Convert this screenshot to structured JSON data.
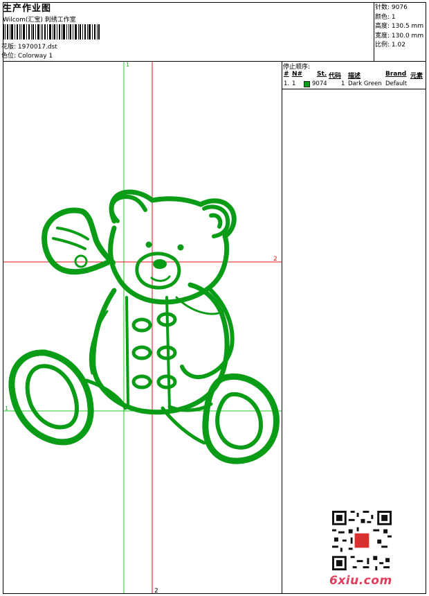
{
  "header": {
    "title": "生产作业图",
    "subtitle": "Wilcom(汇宝) 刺绣工作室",
    "file_label": "花版:",
    "file_value": "1970017.dst",
    "colorway_label": "色位:",
    "colorway_value": "Colorway 1"
  },
  "stats": {
    "stitches_label": "针数:",
    "stitches_value": "9076",
    "colors_label": "颜色:",
    "colors_value": "1",
    "height_label": "高度:",
    "height_value": "130.5 mm",
    "width_label": "宽度:",
    "width_value": "130.0 mm",
    "scale_label": "比例:",
    "scale_value": "1.02"
  },
  "guides": {
    "green_top": "1",
    "green_left": "1",
    "red_right": "2",
    "red_bottom": "2"
  },
  "stop_sequence": {
    "title": "停止顺序:",
    "headers": {
      "num": "#",
      "no": "N#",
      "st": "St.",
      "code": "代码",
      "desc": "描述",
      "brand": "Brand",
      "element": "元素"
    },
    "rows": [
      {
        "num": "1.",
        "no": "1",
        "st": "9074",
        "code": "1",
        "desc": "Dark Green",
        "brand": "Default",
        "swatch_color": "#0a9c16"
      }
    ]
  },
  "thread_color": "#0a9c16",
  "watermark": "6xiu.com"
}
